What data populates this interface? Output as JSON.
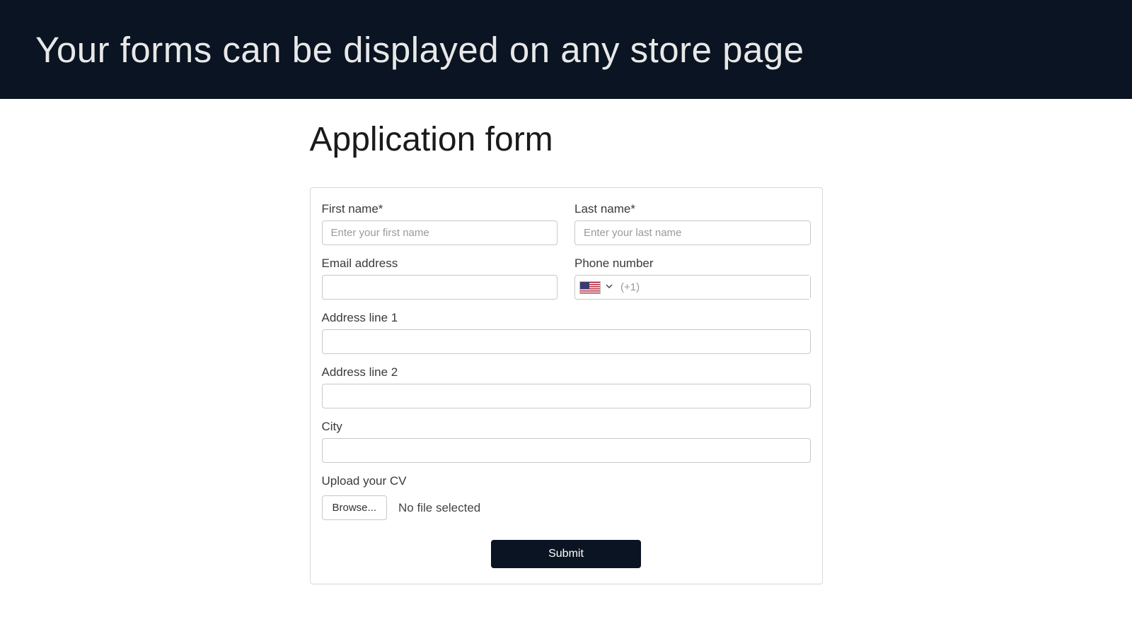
{
  "header": {
    "title": "Your forms can be displayed on any store page"
  },
  "form": {
    "title": "Application form",
    "fields": {
      "first_name": {
        "label": "First name*",
        "placeholder": "Enter your first name"
      },
      "last_name": {
        "label": "Last name*",
        "placeholder": "Enter your last name"
      },
      "email": {
        "label": "Email address"
      },
      "phone": {
        "label": "Phone number",
        "placeholder": "(+1)",
        "country": "US"
      },
      "address1": {
        "label": "Address line 1"
      },
      "address2": {
        "label": "Address line 2"
      },
      "city": {
        "label": "City"
      },
      "upload": {
        "label": "Upload your CV",
        "browse_label": "Browse...",
        "status": "No file selected"
      }
    },
    "submit_label": "Submit"
  }
}
